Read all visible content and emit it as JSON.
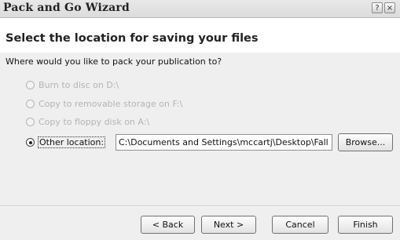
{
  "window": {
    "title": "Pack and Go Wizard",
    "help_glyph": "?",
    "close_glyph": "×"
  },
  "heading": "Select the location for saving your files",
  "question": "Where would you like to pack your publication to?",
  "options": [
    {
      "label": "Burn to disc on D:\\",
      "enabled": false,
      "selected": false
    },
    {
      "label": "Copy to removable storage on F:\\",
      "enabled": false,
      "selected": false
    },
    {
      "label": "Copy to floppy disk on A:\\",
      "enabled": false,
      "selected": false
    },
    {
      "label": "Other location:",
      "enabled": true,
      "selected": true
    }
  ],
  "location_value": "C:\\Documents and Settings\\mccartj\\Desktop\\Fall N",
  "buttons": {
    "browse": "Browse...",
    "back": "< Back",
    "next": "Next >",
    "cancel": "Cancel",
    "finish": "Finish"
  }
}
